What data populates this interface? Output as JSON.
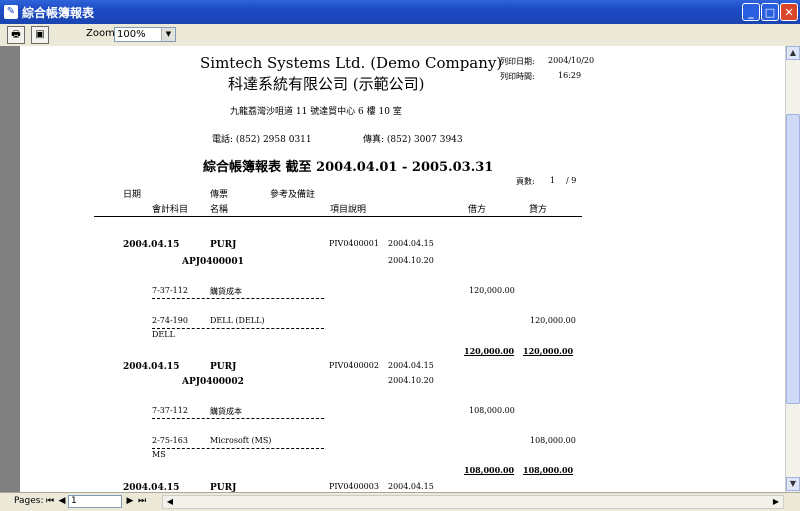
{
  "window": {
    "title": "綜合帳簿報表",
    "app_icon": "report-icon"
  },
  "toolbar": {
    "zoom_label": "Zoom",
    "zoom_value": "100%"
  },
  "report": {
    "company_en": "Simtech Systems Ltd. (Demo Company)",
    "company_zh": "科達系統有限公司 (示範公司)",
    "address": "九龍荔灣沙咀道 11 號達貿中心 6 樓 10 室",
    "phone": "電話: (852) 2958 0311",
    "fax": "傳真: (852) 3007 3943",
    "print_date_label": "列印日期:",
    "print_date": "2004/10/20",
    "print_time_label": "列印時間:",
    "print_time": "16:29",
    "title": "綜合帳簿報表 截至 2004.04.01 - 2005.03.31",
    "page_label": "頁數:",
    "page_current": "1",
    "page_total": "/ 9",
    "col_date": "日期",
    "col_voucher": "傳票",
    "col_ref": "參考及備註",
    "col_account": "會計科目",
    "col_name": "名稱",
    "col_desc": "項目說明",
    "col_debit": "借方",
    "col_credit": "貸方",
    "entries": [
      {
        "date": "2004.04.15",
        "type": "PURJ",
        "voucher": "APJ0400001",
        "ref": "PIV0400001",
        "ref_date": "2004.04.15",
        "ref_date2": "2004.10.20",
        "line1_code": "7-37-112",
        "line1_name": "購貨成本",
        "line1_debit": "120,000.00",
        "line2_code": "2-74-190",
        "line2_name": "DELL (DELL)",
        "line2_credit": "120,000.00",
        "line2_note": "DELL",
        "total_debit": "120,000.00",
        "total_credit": "120,000.00"
      },
      {
        "date": "2004.04.15",
        "type": "PURJ",
        "voucher": "APJ0400002",
        "ref": "PIV0400002",
        "ref_date": "2004.04.15",
        "ref_date2": "2004.10.20",
        "line1_code": "7-37-112",
        "line1_name": "購貨成本",
        "line1_debit": "108,000.00",
        "line2_code": "2-75-163",
        "line2_name": "Microsoft (MS)",
        "line2_credit": "108,000.00",
        "line2_note": "MS",
        "total_debit": "108,000.00",
        "total_credit": "108,000.00"
      },
      {
        "date": "2004.04.15",
        "type": "PURJ",
        "ref": "PIV0400003",
        "ref_date": "2004.04.15"
      }
    ]
  },
  "statusbar": {
    "pages_label": "Pages:",
    "page_value": "1"
  }
}
